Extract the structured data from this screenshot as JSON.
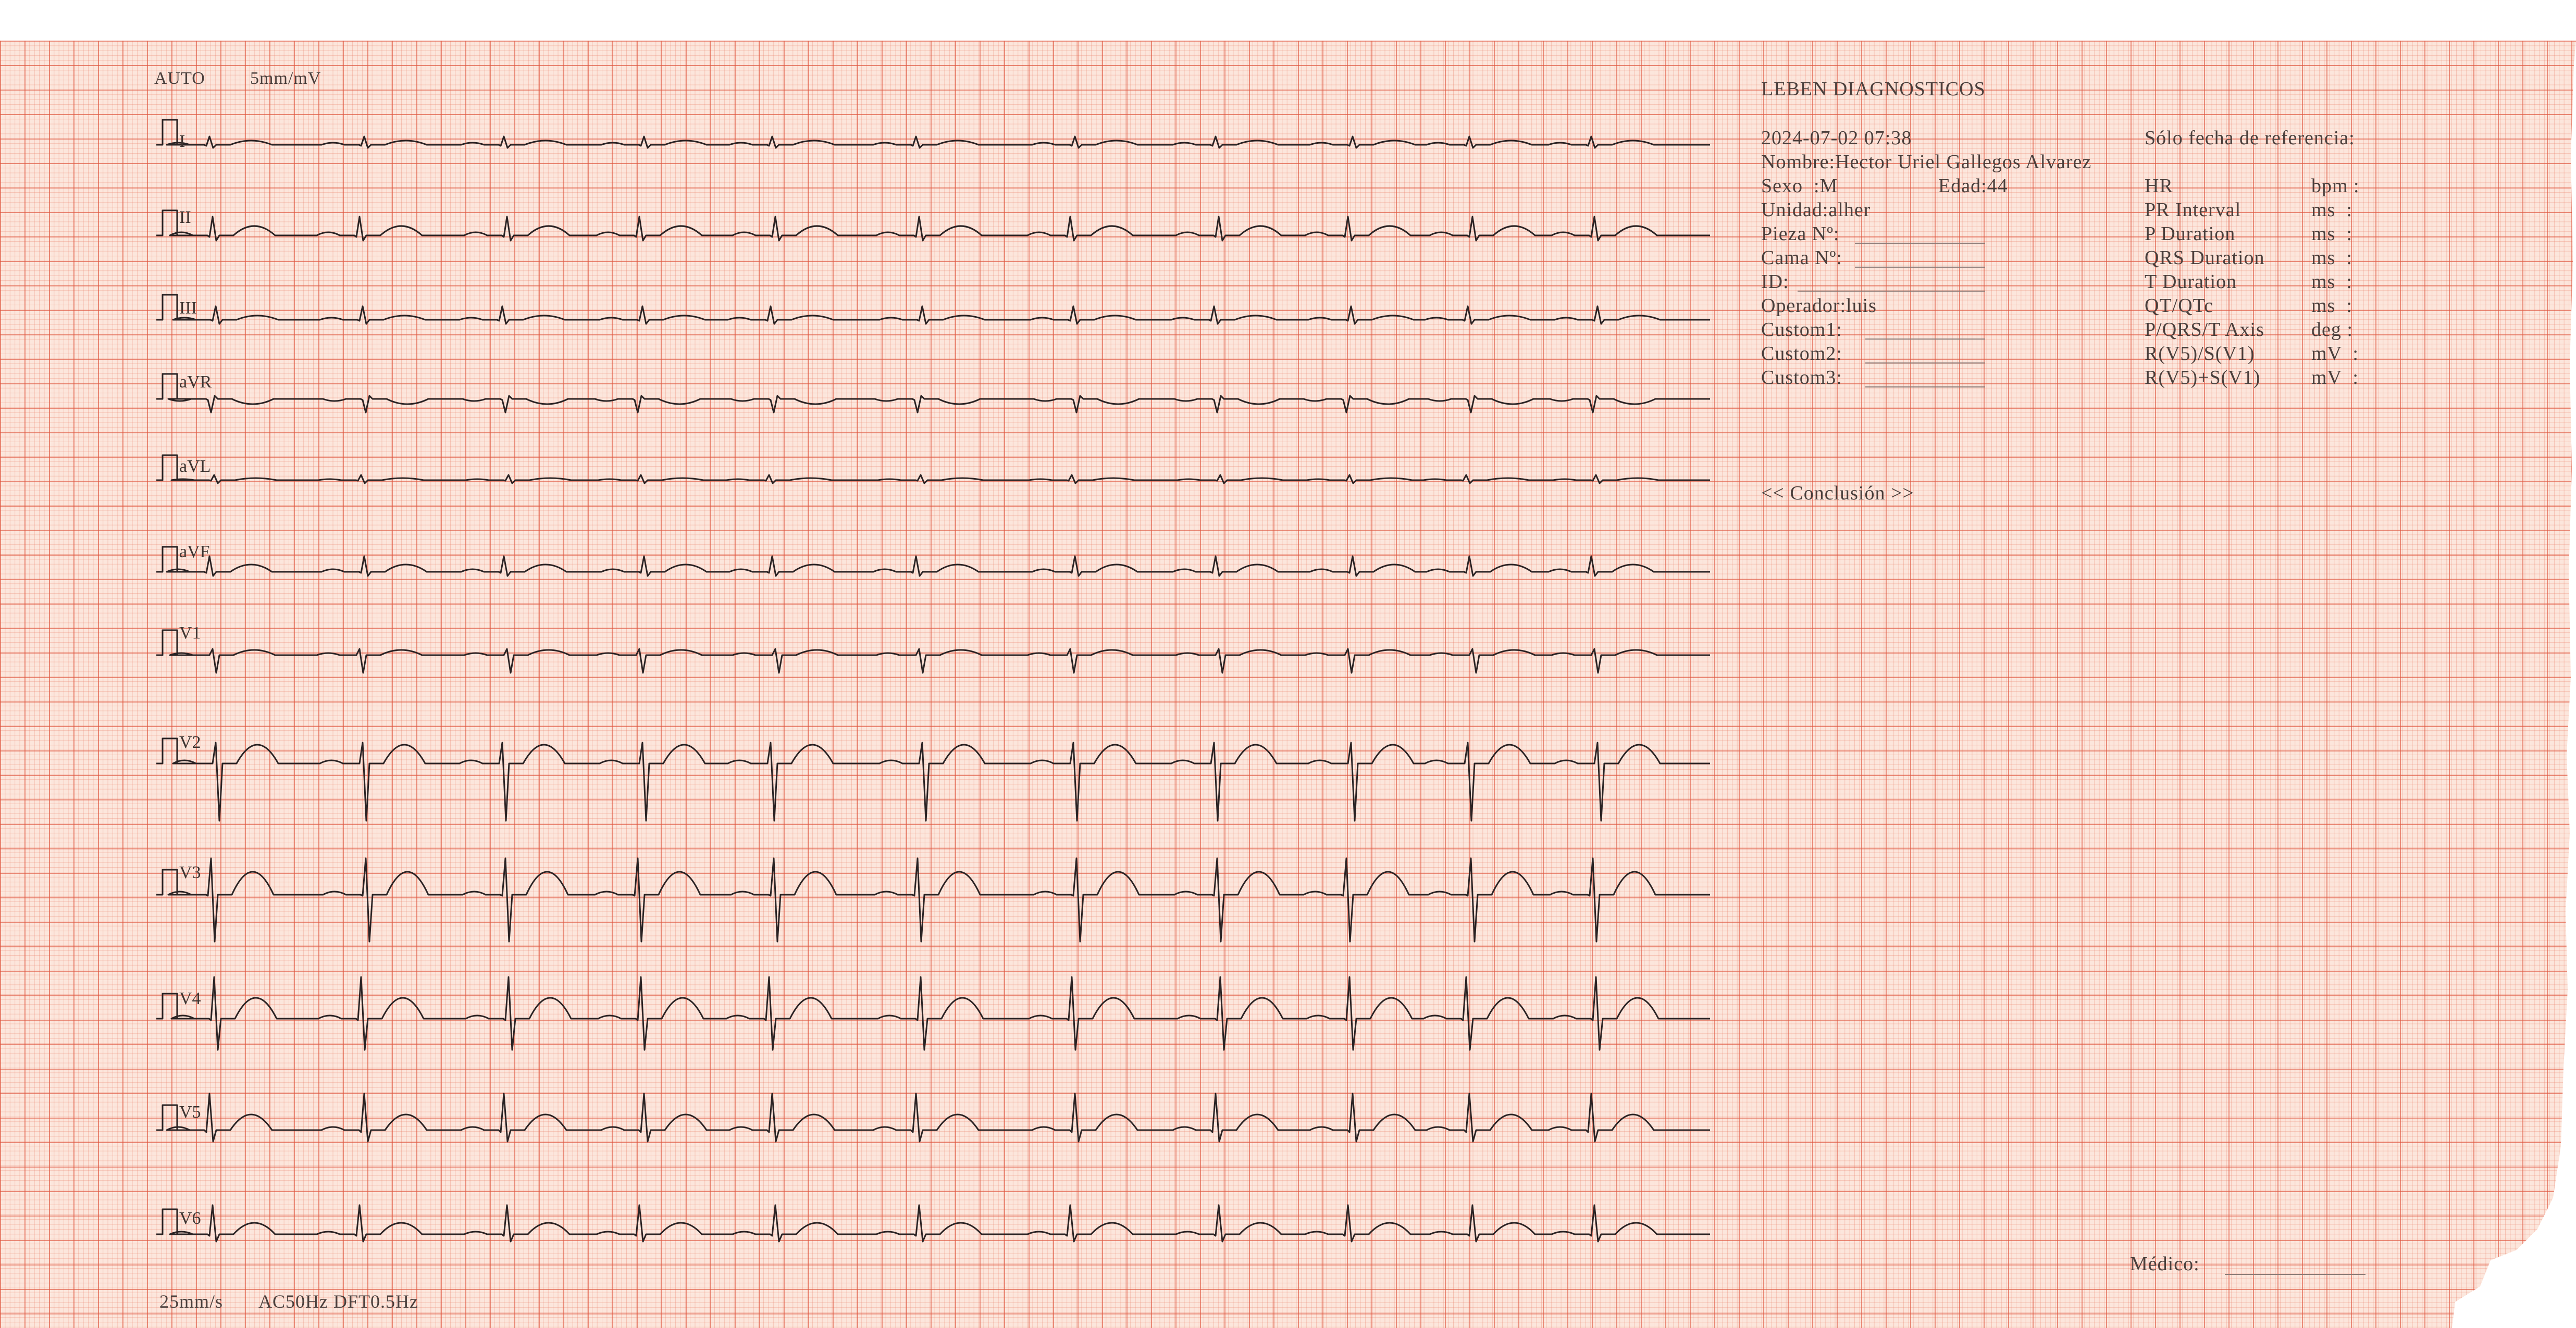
{
  "header": {
    "mode": "AUTO",
    "gain": "5mm/mV"
  },
  "footer": {
    "speed": "25mm/s",
    "filters": "AC50Hz DFT0.5Hz"
  },
  "institution": "LEBEN DIAGNOSTICOS",
  "datetime": "2024-07-02 07:38",
  "reference_note": "Sólo fecha de referencia:",
  "patient": {
    "name_line": "Nombre:Hector Uriel Gallegos Alvarez",
    "sex_line": "Sexo  :M",
    "age_line": "Edad:44",
    "unit_line": "Unidad:alher",
    "piece_line": "Pieza Nº:",
    "bed_line": "Cama Nº:",
    "id_line": "ID:",
    "operator_line": "Operador:luis",
    "custom1_line": "Custom1:",
    "custom2_line": "Custom2:",
    "custom3_line": "Custom3:"
  },
  "measurements": [
    {
      "label": "HR",
      "unit": "bpm :"
    },
    {
      "label": "PR Interval",
      "unit": "ms  :"
    },
    {
      "label": "P Duration",
      "unit": "ms  :"
    },
    {
      "label": "QRS Duration",
      "unit": "ms  :"
    },
    {
      "label": "T Duration",
      "unit": "ms  :"
    },
    {
      "label": "QT/QTc",
      "unit": "ms  :"
    },
    {
      "label": "P/QRS/T Axis",
      "unit": "deg :"
    },
    {
      "label": "R(V5)/S(V1)",
      "unit": "mV  :"
    },
    {
      "label": "R(V5)+S(V1)",
      "unit": "mV  :"
    }
  ],
  "conclusion_label": "<< Conclusión >>",
  "physician_label": "Médico:",
  "leads": [
    "I",
    "II",
    "III",
    "aVR",
    "aVL",
    "aVF",
    "V1",
    "V2",
    "V3",
    "V4",
    "V5",
    "V6"
  ],
  "colors": {
    "grid_major": "#de563e",
    "grid_minor": "#e87860",
    "paper": "#fce6dc",
    "trace": "#2a2324",
    "print_text": "#4a3f3c"
  }
}
